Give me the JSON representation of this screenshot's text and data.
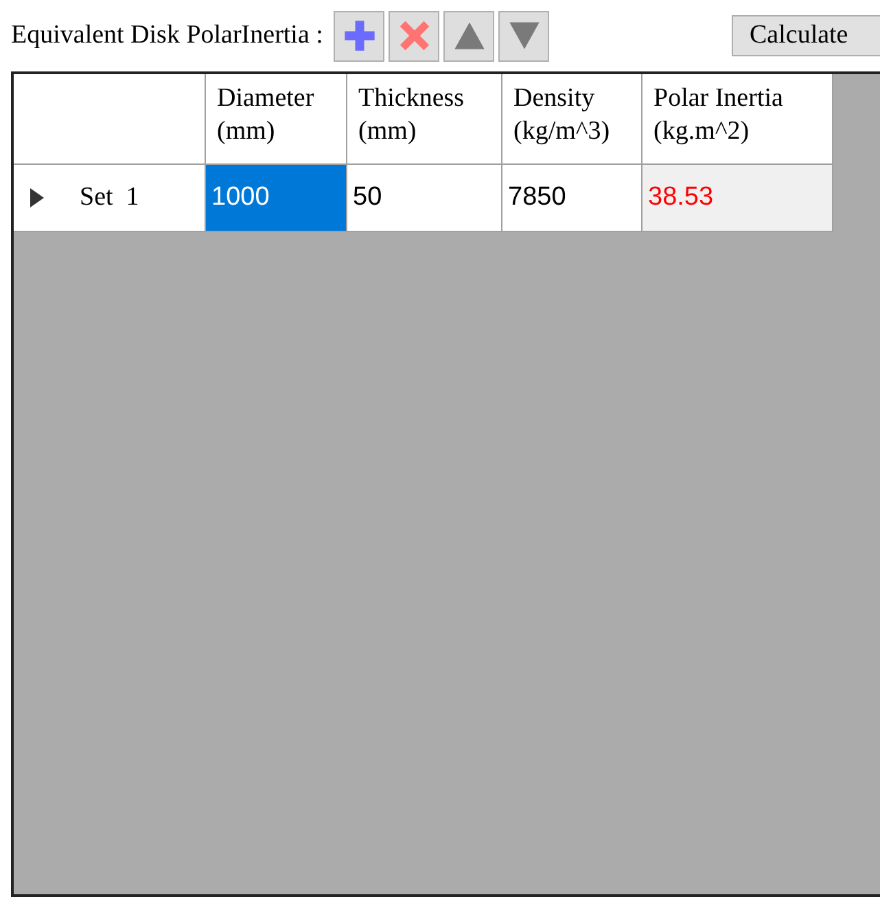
{
  "toolbar": {
    "label": "Equivalent Disk PolarInertia :",
    "tools": [
      {
        "kind": "add"
      },
      {
        "kind": "delete"
      },
      {
        "kind": "up"
      },
      {
        "kind": "down"
      }
    ],
    "calculate_button": "Calculate"
  },
  "grid": {
    "columns": [
      {
        "line1": "Diameter",
        "line2": "(mm)"
      },
      {
        "line1": "Thickness",
        "line2": "(mm)"
      },
      {
        "line1": "Density",
        "line2": "(kg/m^3)"
      },
      {
        "line1": "Polar Inertia",
        "line2": "(kg.m^2)"
      }
    ],
    "rows": [
      {
        "label": "Set  1",
        "current": true,
        "cells": [
          {
            "value": "1000",
            "kind": "input",
            "selected": true
          },
          {
            "value": "50",
            "kind": "input",
            "selected": false
          },
          {
            "value": "7850",
            "kind": "input",
            "selected": false
          },
          {
            "value": "38.53",
            "kind": "result",
            "selected": false
          }
        ]
      }
    ]
  }
}
